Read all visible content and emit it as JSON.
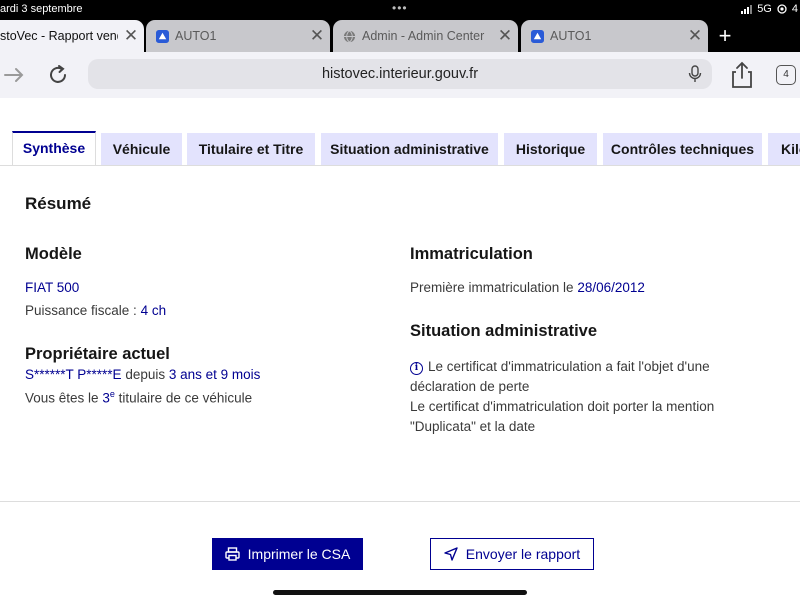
{
  "status_bar": {
    "date": "ardi 3 septembre",
    "dots": "•••",
    "network": "5G",
    "battery": "4"
  },
  "browser": {
    "tabs": [
      {
        "title": "stoVec - Rapport vende",
        "active": true
      },
      {
        "title": "AUTO1",
        "active": false
      },
      {
        "title": "Admin - Admin Center",
        "active": false
      },
      {
        "title": "AUTO1",
        "active": false
      }
    ],
    "new_tab": "+",
    "url": "histovec.interieur.gouv.fr",
    "tab_count": "4"
  },
  "page": {
    "tabs": [
      "Synthèse",
      "Véhicule",
      "Titulaire et Titre",
      "Situation administrative",
      "Historique",
      "Contrôles techniques",
      "Kilo"
    ],
    "resume_title": "Résumé",
    "modele": {
      "title": "Modèle",
      "model_name": "FIAT 500",
      "puissance_label": "Puissance fiscale : ",
      "puissance_value": "4 ch"
    },
    "proprietaire": {
      "title": "Propriétaire actuel",
      "name": "S******T P*****E",
      "since_label": " depuis ",
      "since_value": "3 ans et 9 mois",
      "rank_prefix": "Vous êtes le ",
      "rank_number": "3",
      "rank_sup": "e",
      "rank_suffix": " titulaire de ce véhicule"
    },
    "immatriculation": {
      "title": "Immatriculation",
      "label": "Première immatriculation le ",
      "date": "28/06/2012"
    },
    "situation": {
      "title": "Situation administrative",
      "line1": "Le certificat d'immatriculation a fait l'objet d'une",
      "line2": "déclaration de perte",
      "line3": "Le certificat d'immatriculation doit porter la mention",
      "line4": "\"Duplicata\" et la date"
    },
    "buttons": {
      "print": "Imprimer le CSA",
      "send": "Envoyer le rapport"
    }
  },
  "colors": {
    "accent": "#000091",
    "tab_bg": "#e3e3fd"
  }
}
